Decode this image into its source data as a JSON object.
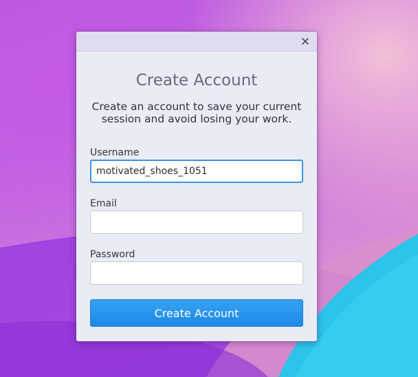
{
  "window": {
    "close_icon": "close-icon",
    "close_label": "Close"
  },
  "form": {
    "title": "Create Account",
    "subtitle": "Create an account to save your current session and avoid losing your work.",
    "username": {
      "label": "Username",
      "value": "motivated_shoes_1051",
      "placeholder": ""
    },
    "email": {
      "label": "Email",
      "value": "",
      "placeholder": ""
    },
    "password": {
      "label": "Password",
      "value": "",
      "placeholder": ""
    },
    "submit_label": "Create Account"
  },
  "colors": {
    "accent": "#1d88e6",
    "focus_ring": "#3a93e6",
    "dialog_bg": "#eaecf5",
    "title_text": "#646a7d"
  }
}
